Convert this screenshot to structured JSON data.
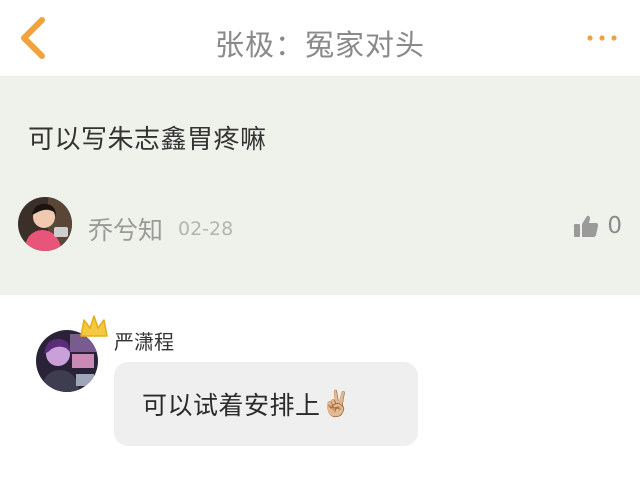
{
  "header": {
    "title": "张极：冤家对头",
    "back_icon": "chevron-left-icon",
    "more_icon": "more-dots-icon",
    "accent_color": "#f2a23c"
  },
  "post": {
    "text": "可以写朱志鑫胃疼嘛",
    "author": "乔兮知",
    "date": "02-28",
    "likes": "0",
    "background_color": "#eff2ea"
  },
  "reply": {
    "author": "严潇程",
    "text": "可以试着安排上",
    "emoji": "✌🏼",
    "crown_color": "#f5c842"
  }
}
